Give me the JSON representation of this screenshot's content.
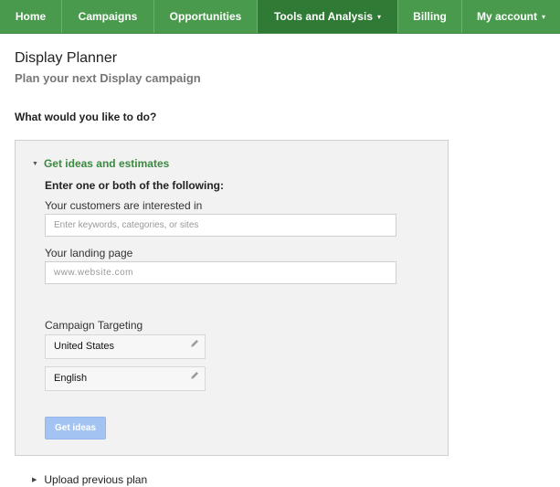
{
  "nav": {
    "items": [
      {
        "label": "Home"
      },
      {
        "label": "Campaigns"
      },
      {
        "label": "Opportunities"
      },
      {
        "label": "Tools and Analysis",
        "active": true
      },
      {
        "label": "Billing"
      },
      {
        "label": "My account"
      }
    ],
    "dropdown_caret": "▾",
    "colors": {
      "bar": "#4a9a4e",
      "active": "#2f7a34"
    }
  },
  "page": {
    "title": "Display Planner",
    "subtitle": "Plan your next Display campaign",
    "question": "What would you like to do?"
  },
  "panel": {
    "section_label": "Get ideas and estimates",
    "expanded_arrow": "▼",
    "instruction": "Enter one or both of the following:",
    "interests_label": "Your customers are interested in",
    "interests_placeholder": "Enter keywords, categories, or sites",
    "landing_label": "Your landing page",
    "landing_placeholder": "www.website.com",
    "targeting_label": "Campaign Targeting",
    "targeting": [
      {
        "value": "United States",
        "icon": "pencil-icon"
      },
      {
        "value": "English",
        "icon": "pencil-icon"
      }
    ],
    "button_label": "Get ideas",
    "colors": {
      "link_green": "#3b8a3f",
      "button": "#a3c3f2"
    }
  },
  "upload": {
    "label": "Upload previous plan",
    "collapsed_arrow": "▶"
  }
}
